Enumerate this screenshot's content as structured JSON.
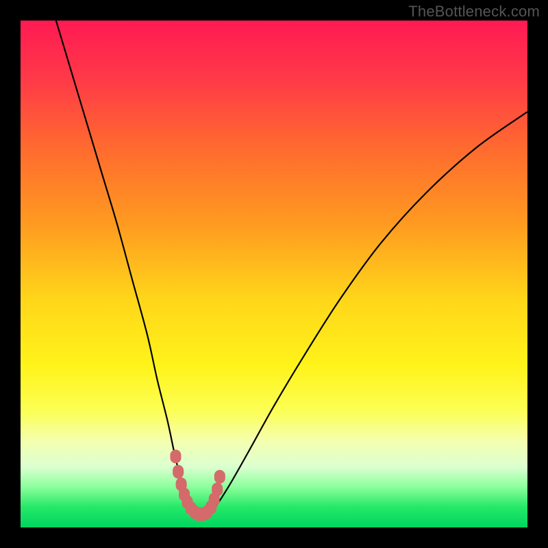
{
  "watermark": "TheBottleneck.com",
  "chart_data": {
    "type": "line",
    "title": "",
    "xlabel": "",
    "ylabel": "",
    "xlim": [
      0,
      100
    ],
    "ylim": [
      0,
      100
    ],
    "description": "Bottleneck curve: value drops from 100 toward 0 at the optimal match (around x≈34) then rises again. Red-to-green vertical gradient encodes bottleneck severity (red=high, green=low).",
    "series": [
      {
        "name": "bottleneck-curve",
        "x": [
          7,
          10,
          13,
          16,
          19,
          22,
          25,
          27,
          29,
          30.5,
          32,
          33.5,
          34.5,
          36,
          38,
          41,
          45,
          50,
          56,
          63,
          71,
          80,
          90,
          100
        ],
        "values": [
          100,
          90,
          80,
          70,
          60,
          49,
          38,
          29,
          21,
          14,
          8,
          3.5,
          2,
          2,
          3.5,
          8,
          15,
          24,
          34,
          45,
          56,
          66,
          75,
          82
        ]
      }
    ],
    "markers": {
      "color": "#d46a6a",
      "points_x": [
        30.6,
        31.1,
        31.7,
        32.3,
        32.9,
        33.6,
        34.4,
        35.2,
        36.0,
        36.8,
        37.6,
        38.2,
        38.8,
        39.3
      ],
      "points_y": [
        14.0,
        11.0,
        8.5,
        6.5,
        5.0,
        3.8,
        3.0,
        2.6,
        2.6,
        3.0,
        4.0,
        5.5,
        7.5,
        10.0
      ]
    }
  }
}
